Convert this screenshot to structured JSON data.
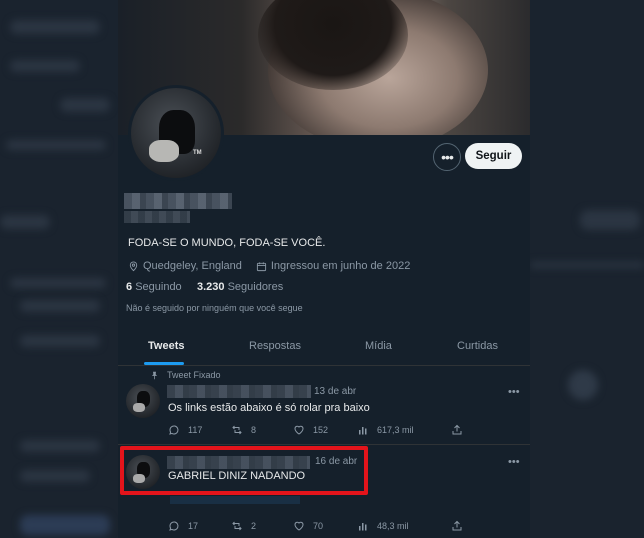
{
  "profile": {
    "bio": "FODA-SE O MUNDO, FODA-SE VOCÊ.",
    "location": "Quedgeley, England",
    "joined": "Ingressou em junho de 2022",
    "following_count": "6",
    "following_label": "Seguindo",
    "followers_count": "3.230",
    "followers_label": "Seguidores",
    "not_followed_text": "Não é seguido por ninguém que você segue",
    "avatar_badge": "TM"
  },
  "actions": {
    "more_label": "•••",
    "follow_label": "Seguir"
  },
  "tabs": [
    {
      "label": "Tweets",
      "active": true
    },
    {
      "label": "Respostas",
      "active": false
    },
    {
      "label": "Mídia",
      "active": false
    },
    {
      "label": "Curtidas",
      "active": false
    }
  ],
  "tweets": [
    {
      "pinned_label": "Tweet Fixado",
      "date": "13 de abr",
      "text": "Os links estão abaixo é só rolar pra baixo",
      "replies": "117",
      "retweets": "8",
      "likes": "152",
      "views": "617,3 mil",
      "more": "•••"
    },
    {
      "date": "16 de abr",
      "text": "GABRIEL DINIZ NADANDO",
      "replies": "17",
      "retweets": "2",
      "likes": "70",
      "views": "48,3 mil",
      "more": "•••"
    }
  ],
  "colors": {
    "accent": "#1d9bf0",
    "highlight": "#e3141b",
    "background": "#15202b"
  }
}
